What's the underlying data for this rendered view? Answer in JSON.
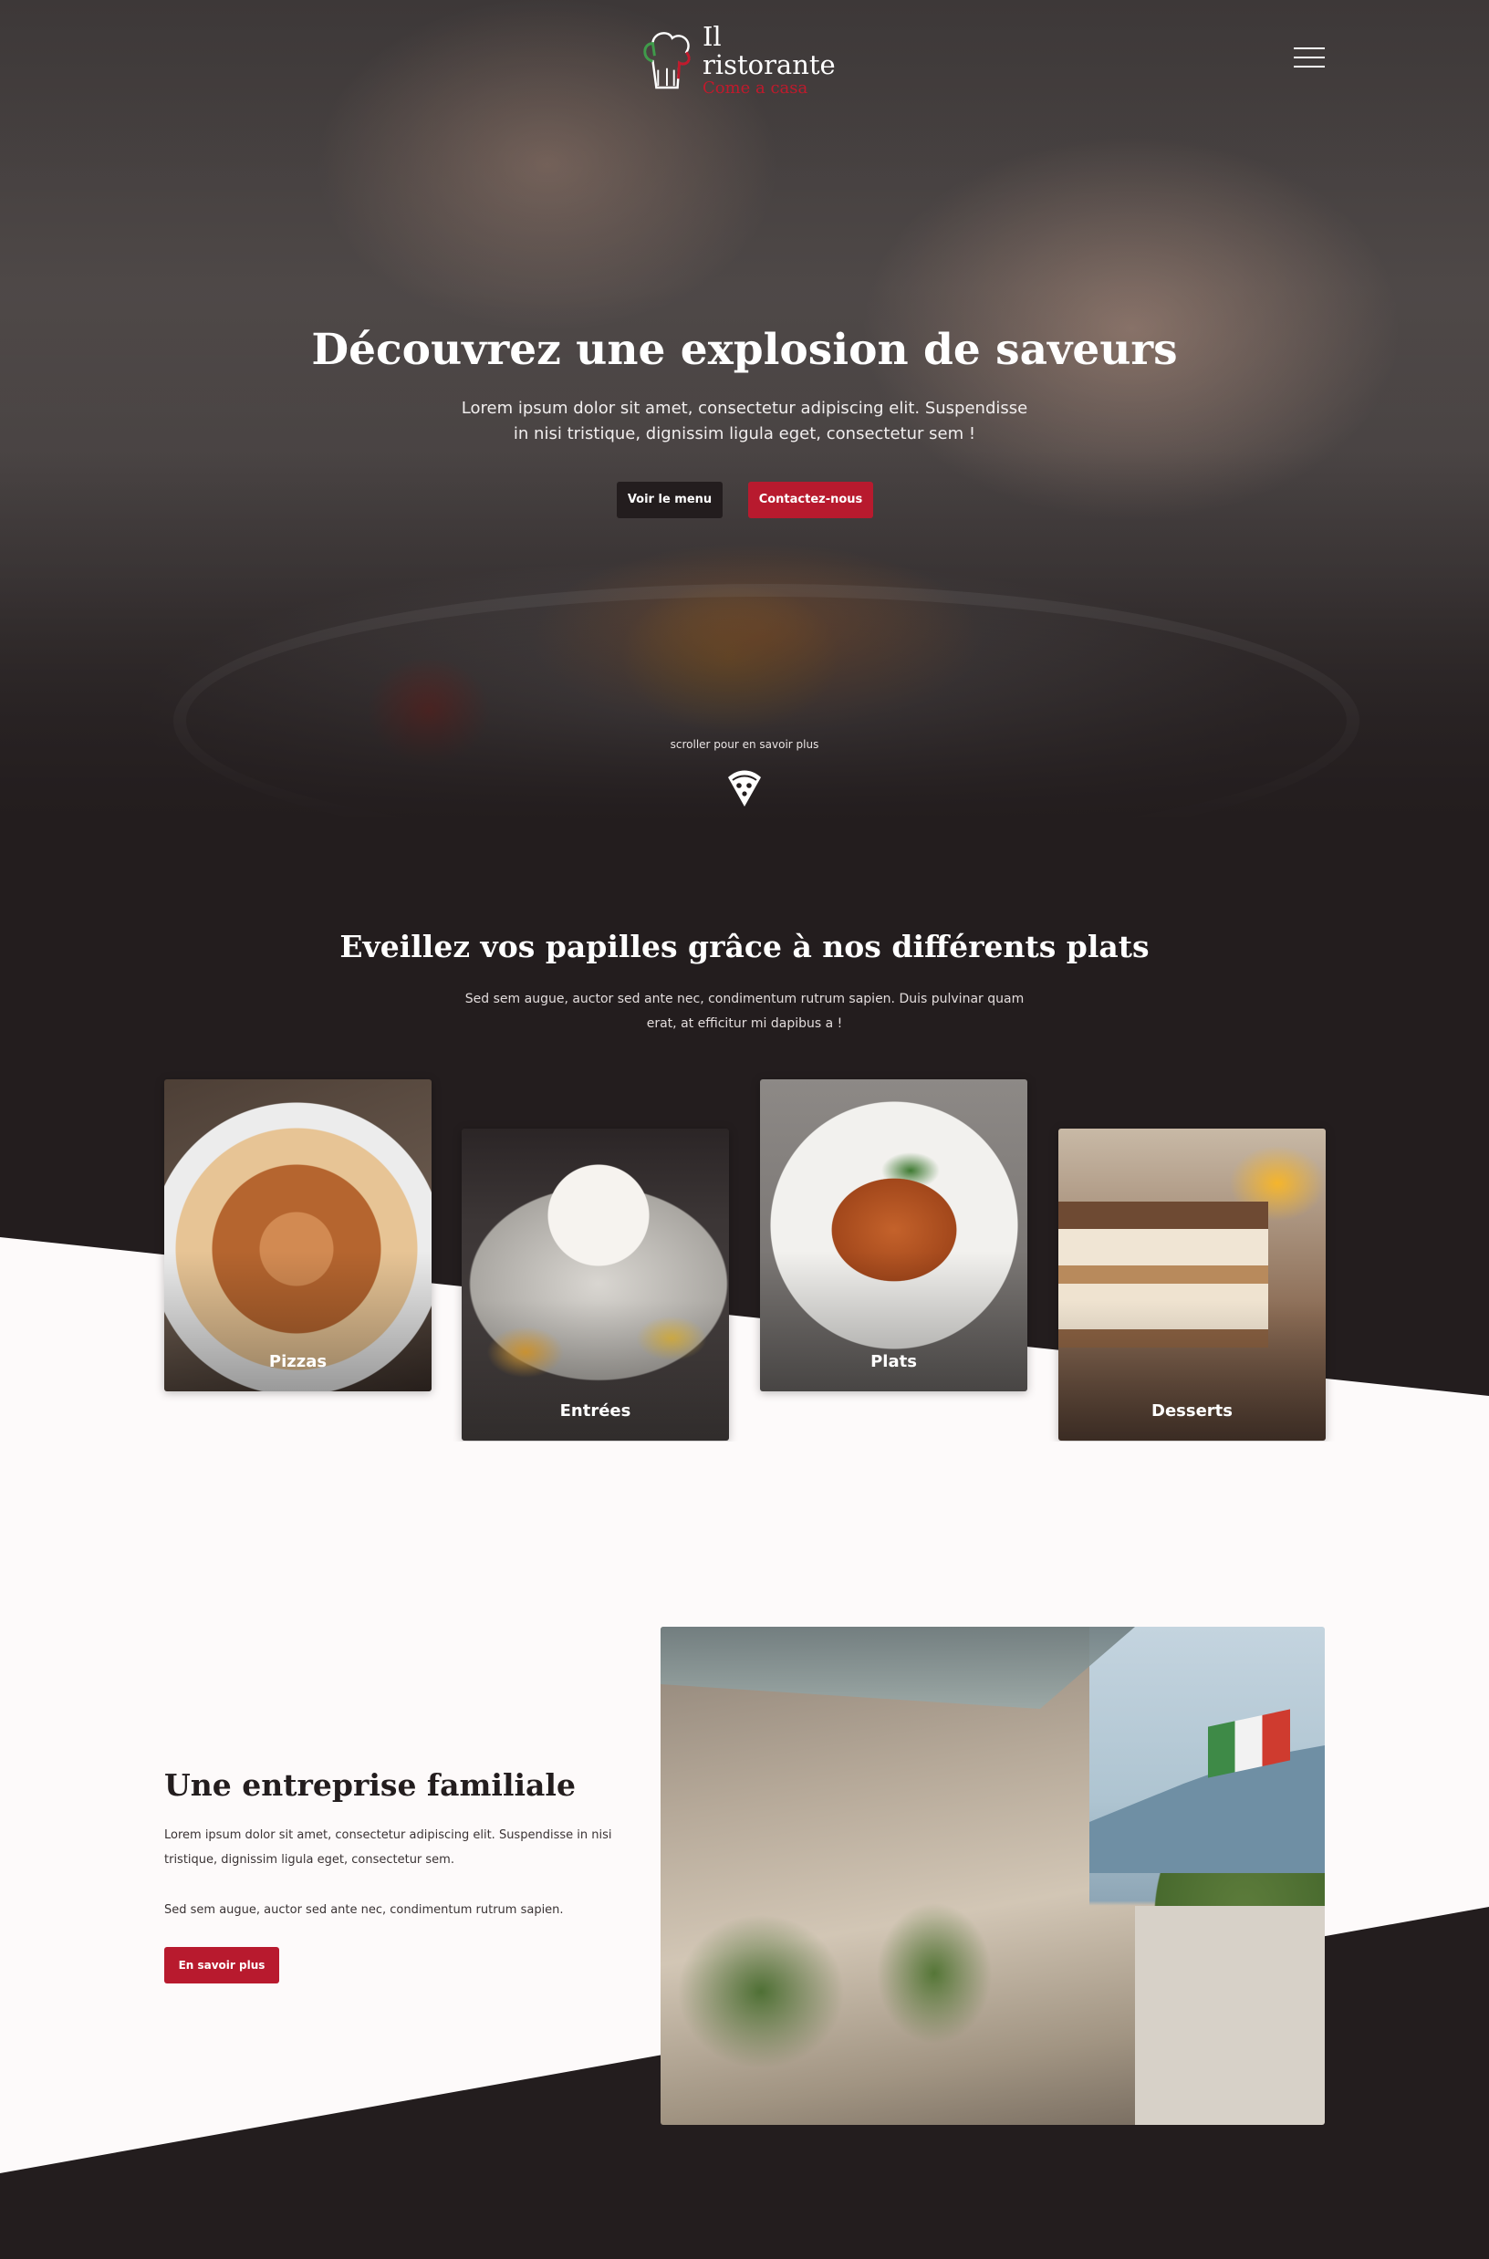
{
  "brand": {
    "title": "Il ristorante",
    "subtitle": "Come a casa"
  },
  "hero": {
    "title": "Découvrez une explosion de saveurs",
    "text": "Lorem ipsum dolor sit amet, consectetur adipiscing elit. Suspendisse in nisi tristique, dignissim ligula eget, consectetur sem !",
    "btn_menu": "Voir le menu",
    "btn_contact": "Contactez-nous",
    "scroll_text": "scroller pour en savoir plus"
  },
  "dishes": {
    "title": "Eveillez vos papilles grâce à nos différents plats",
    "text": "Sed sem augue, auctor sed ante nec, condimentum rutrum sapien. Duis pulvinar quam erat, at efficitur mi dapibus a !",
    "cards": [
      {
        "label": "Pizzas"
      },
      {
        "label": "Entrées"
      },
      {
        "label": "Plats"
      },
      {
        "label": "Desserts"
      }
    ]
  },
  "family": {
    "title": "Une entreprise familiale",
    "text1": "Lorem ipsum dolor sit amet, consectetur adipiscing elit. Suspendisse in nisi tristique, dignissim ligula eget, consectetur sem.",
    "text2": "Sed sem augue, auctor sed ante nec, condimentum rutrum sapien.",
    "btn_more": "En savoir plus"
  },
  "colors": {
    "dark": "#231d1e",
    "accent_red": "#b81a2e",
    "light_bg": "#fdfafa"
  },
  "icons": {
    "logo": "chef-hat-icon",
    "menu": "hamburger-menu-icon",
    "scroll": "pizza-slice-icon"
  }
}
